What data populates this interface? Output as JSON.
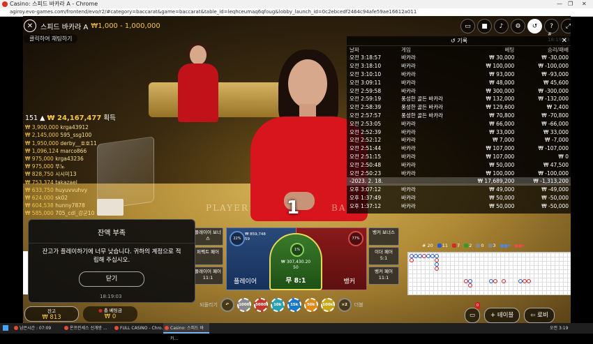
{
  "browser": {
    "window_title": "Casino: 스피드 바카라 A - Chrome",
    "url": "agiroy.evo-games.com/frontend/evo/r2/#category=baccarat&game=baccarat&table_id=leqhceumaq6qfoug&lobby_launch_id=0c2ebcedf2464c94afe59ae16612a011",
    "controls": [
      "—",
      "❐",
      "✕"
    ]
  },
  "header": {
    "close_icon": "✕",
    "table_name": "스피드 바카라 A",
    "stake_range": "₩1,000 - 1,000,000",
    "chat_placeholder": "클릭하여 채팅하기",
    "clock": "# 18:19:03",
    "icons": [
      "chat-icon",
      "video-icon",
      "sound-icon",
      "gear-icon",
      "history-icon",
      "help-icon",
      "fullscreen-icon"
    ]
  },
  "history": {
    "title": "기록",
    "columns": [
      "날짜",
      "게임",
      "베팅",
      "승리/패배"
    ],
    "rows": [
      {
        "date": "오전 3:18:57",
        "game": "바카라",
        "bet": "₩ 30,000",
        "result": "₩ -30,000"
      },
      {
        "date": "오전 3:18:10",
        "game": "바카라",
        "bet": "₩ 100,000",
        "result": "₩ -100,000"
      },
      {
        "date": "오전 3:10:10",
        "game": "바카라",
        "bet": "₩ 93,000",
        "result": "₩ -93,000"
      },
      {
        "date": "오전 3:09:11",
        "game": "바카라",
        "bet": "₩ 48,000",
        "result": "₩ 45,600"
      },
      {
        "date": "오전 2:59:58",
        "game": "바카라",
        "bet": "₩ 300,000",
        "result": "₩ -300,000"
      },
      {
        "date": "오전 2:59:19",
        "game": "풍성한 골든 바카라",
        "bet": "₩ 132,000",
        "result": "₩ -132,000"
      },
      {
        "date": "오전 2:58:39",
        "game": "풍성한 골든 바카라",
        "bet": "₩ 129,600",
        "result": "₩ 2,400"
      },
      {
        "date": "오전 2:57:57",
        "game": "풍성한 골든 바카라",
        "bet": "₩ 70,800",
        "result": "₩ -70,800"
      },
      {
        "date": "오전 2:53:05",
        "game": "바카라",
        "bet": "₩ 66,000",
        "result": "₩ -66,000"
      },
      {
        "date": "오전 2:52:39",
        "game": "바카라",
        "bet": "₩ 33,000",
        "result": "₩ 33,000"
      },
      {
        "date": "오전 2:52:12",
        "game": "바카라",
        "bet": "₩ 7,000",
        "result": "₩ -7,000"
      },
      {
        "date": "오전 2:51:44",
        "game": "바카라",
        "bet": "₩ 107,000",
        "result": "₩ -107,000"
      },
      {
        "date": "오전 2:51:15",
        "game": "바카라",
        "bet": "₩ 107,000",
        "result": "₩ 0"
      },
      {
        "date": "오전 2:50:48",
        "game": "바카라",
        "bet": "₩ 50,000",
        "result": "₩ 47,500"
      },
      {
        "date": "오전 2:50:23",
        "game": "바카라",
        "bet": "₩ 100,000",
        "result": "₩ -100,000"
      },
      {
        "date": "-2023. 2. 18.",
        "game": "",
        "bet": "₩ 17,689,200",
        "result": "₩ -1,313,200",
        "is_date": true
      },
      {
        "date": "오후 3:07:12",
        "game": "바카라",
        "bet": "₩ 49,000",
        "result": "₩ -49,000"
      },
      {
        "date": "오후 1:37:49",
        "game": "바카라",
        "bet": "₩ 50,000",
        "result": "₩ -50,000"
      },
      {
        "date": "오후 1:37:12",
        "game": "바카라",
        "bet": "₩ 50,000",
        "result": "₩ -50,000"
      }
    ]
  },
  "winners": {
    "count": "151",
    "total": "₩ 24,167,477",
    "suffix": "획득",
    "list": [
      {
        "amt": "₩ 3,900,000",
        "name": "krga43912"
      },
      {
        "amt": "₩ 2,145,000",
        "name": "595_ssg100"
      },
      {
        "amt": "₩ 1,950,000",
        "name": "derby__호호11"
      },
      {
        "amt": "₩ 1,096,124",
        "name": "marco866"
      },
      {
        "amt": "₩ 975,000",
        "name": "krga43236"
      },
      {
        "amt": "₩ 975,000",
        "name": "뚜노"
      },
      {
        "amt": "₩ 828,750",
        "name": "시시미13"
      },
      {
        "amt": "₩ 753,374",
        "name": "takazael"
      },
      {
        "amt": "₩ 633,750",
        "name": "huyuvvuhvy"
      },
      {
        "amt": "₩ 624,000",
        "name": "sk02"
      },
      {
        "amt": "₩ 604,538",
        "name": "hunny7878"
      },
      {
        "amt": "₩ 585,000",
        "name": "705_cdl_강군10"
      }
    ]
  },
  "table": {
    "felt_player": "PLAYER",
    "felt_banker": "BA",
    "countdown": "1"
  },
  "bets": {
    "player_bonus": "플레이어 보너스",
    "perfect_pair": "퍼펙트 페어",
    "player_pair": "플레이어 페어",
    "player_pair_odds": "11:1",
    "player_label": "플레이어",
    "player_pct": "22%",
    "player_amt": "₩ 859,748",
    "player_count": "59",
    "tie_label": "무 8:1",
    "tie_pct": "1%",
    "tie_amt": "₩ 307,430.20",
    "tie_count": "50",
    "banker_label": "뱅커",
    "banker_pct": "77%",
    "banker_bonus": "뱅커 보너스",
    "either_pair": "이더 페어",
    "either_pair_odds": "5:1",
    "banker_pair": "뱅커 페어",
    "banker_pair_odds": "11:1"
  },
  "road_summary": {
    "total": "# 20",
    "player": "11",
    "banker": "7",
    "tie": "2",
    "player_pair": "0",
    "banker_pair": "3"
  },
  "modal": {
    "title": "잔액 부족",
    "message": "잔고가 플레이하기에 너무 낮습니다. 귀하의 계정으로 적립해 주십시오.",
    "button": "닫기"
  },
  "bottom": {
    "time": "18:19:03",
    "balance_label": "잔고",
    "balance": "₩ 813",
    "total_bet_label": "총 베팅금",
    "total_bet": "₩ 0",
    "undo": "되돌리기",
    "chips": [
      "1000",
      "5000",
      "10k",
      "15k",
      "50k",
      "100k"
    ],
    "double": "×2",
    "double_label": "더블",
    "table_btn": "+ 테이블",
    "lobby_btn": "로비",
    "badge": "0"
  },
  "taskbar": {
    "items": [
      "남은시간 : 07:09",
      "온프린세스 신개방 ...",
      "FULL CASINO - Chro...",
      "Casino: 스피드 바카..."
    ],
    "clock": "오전 3:19"
  },
  "colors": {
    "gold": "#f4c74b",
    "player_blue": "#2a4a7a",
    "banker_red": "#8a1a1a",
    "tie_green": "#3a7a2a"
  }
}
